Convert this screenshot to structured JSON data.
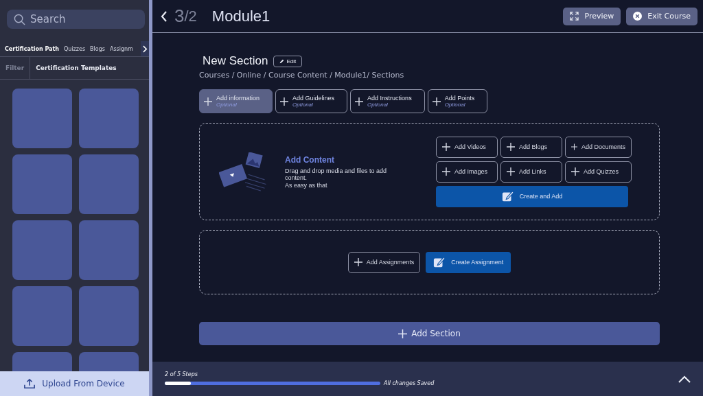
{
  "sidebar": {
    "search": {
      "placeholder": "Search"
    },
    "tabs": [
      {
        "label": "Certification Path",
        "selected": true
      },
      {
        "label": "Quizzes",
        "selected": false
      },
      {
        "label": "Blogs",
        "selected": false
      },
      {
        "label": "Assignm",
        "selected": false
      }
    ],
    "filter_tabs": [
      {
        "label": "Filter",
        "selected": false
      },
      {
        "label": "Certification Templates",
        "selected": true
      }
    ],
    "tiles": [
      {
        "kind": "template"
      },
      {
        "kind": "template"
      },
      {
        "kind": "template"
      },
      {
        "kind": "template"
      },
      {
        "kind": "template"
      },
      {
        "kind": "template"
      },
      {
        "kind": "template"
      },
      {
        "kind": "template"
      },
      {
        "kind": "template"
      },
      {
        "kind": "template"
      }
    ],
    "upload_button": "Upload From Device"
  },
  "header": {
    "step_current": "3",
    "separator": "/",
    "step_total": "2",
    "title": "Module1",
    "buttons": [
      {
        "label": "Preview",
        "kind": "preview"
      },
      {
        "label": "Exit Course",
        "kind": "exit"
      }
    ]
  },
  "section": {
    "title": "New Section",
    "edit_button": "Edit",
    "breadcrumb": "Courses / Online / Course Content / Module1/ Sections",
    "info_buttons": [
      {
        "label": "Add information",
        "hint": "Optional",
        "selected": true
      },
      {
        "label": "Add Guidelines",
        "hint": "Optional",
        "selected": false
      },
      {
        "label": "Add Instructions",
        "hint": "Optional",
        "selected": false
      },
      {
        "label": "Add Points",
        "hint": "Optional",
        "selected": false
      }
    ],
    "content": {
      "title": "Add Content",
      "description": "Drag and drop media and files to add content.",
      "note": "As easy as that",
      "add_buttons": [
        "Add Videos",
        "Add Blogs",
        "Add Documents",
        "Add Images",
        "Add Links",
        "Add Quizzes"
      ],
      "create_button": "Create and Add"
    },
    "assignments": {
      "add_button": "Add Assignments",
      "create_button": "Create Assignment"
    }
  },
  "add_section_button": "Add Section",
  "footer": {
    "steps": "2 of 5 Steps",
    "level": 0.12,
    "status": "All changes Saved"
  }
}
